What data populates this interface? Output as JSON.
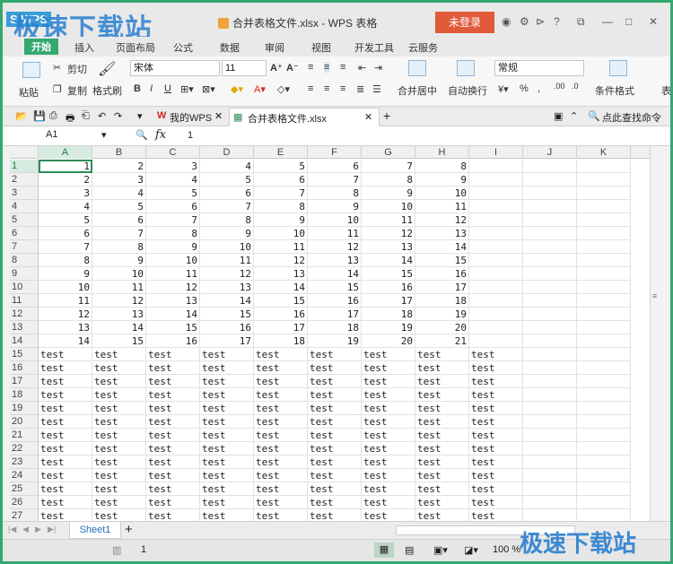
{
  "titlebar": {
    "app_logo": "S WPS",
    "watermark": "极速下载站",
    "doc_title": "合并表格文件.xlsx - WPS 表格",
    "login": "未登录",
    "icons": [
      "skin-icon",
      "settings-icon",
      "share-icon",
      "help-icon",
      "minimize-icon",
      "restore-icon",
      "maximize-icon",
      "close-icon"
    ]
  },
  "ribbon_tabs": [
    "开始",
    "插入",
    "页面布局",
    "公式",
    "数据",
    "审阅",
    "视图",
    "开发工具",
    "云服务"
  ],
  "ribbon": {
    "paste": "粘贴",
    "cut": "剪切",
    "copy": "复制",
    "format_painter": "格式刷",
    "font_name": "宋体",
    "font_size": "11",
    "merge_center": "合并居中",
    "wrap_text": "自动换行",
    "number_format": "常规",
    "conditional_format": "条件格式",
    "last_label": "表"
  },
  "doc_tabs": {
    "my_wps": "我的WPS",
    "active_doc": "合并表格文件.xlsx",
    "search": "点此查找命令"
  },
  "formula_bar": {
    "name_box": "A1",
    "fx": "fx",
    "value": "1"
  },
  "columns": [
    "A",
    "B",
    "C",
    "D",
    "E",
    "F",
    "G",
    "H",
    "I",
    "J",
    "K"
  ],
  "rows": [
    [
      "1",
      "2",
      "3",
      "4",
      "5",
      "6",
      "7",
      "8"
    ],
    [
      "2",
      "3",
      "4",
      "5",
      "6",
      "7",
      "8",
      "9"
    ],
    [
      "3",
      "4",
      "5",
      "6",
      "7",
      "8",
      "9",
      "10"
    ],
    [
      "4",
      "5",
      "6",
      "7",
      "8",
      "9",
      "10",
      "11"
    ],
    [
      "5",
      "6",
      "7",
      "8",
      "9",
      "10",
      "11",
      "12"
    ],
    [
      "6",
      "7",
      "8",
      "9",
      "10",
      "11",
      "12",
      "13"
    ],
    [
      "7",
      "8",
      "9",
      "10",
      "11",
      "12",
      "13",
      "14"
    ],
    [
      "8",
      "9",
      "10",
      "11",
      "12",
      "13",
      "14",
      "15"
    ],
    [
      "9",
      "10",
      "11",
      "12",
      "13",
      "14",
      "15",
      "16"
    ],
    [
      "10",
      "11",
      "12",
      "13",
      "14",
      "15",
      "16",
      "17"
    ],
    [
      "11",
      "12",
      "13",
      "14",
      "15",
      "16",
      "17",
      "18"
    ],
    [
      "12",
      "13",
      "14",
      "15",
      "16",
      "17",
      "18",
      "19"
    ],
    [
      "13",
      "14",
      "15",
      "16",
      "17",
      "18",
      "19",
      "20"
    ],
    [
      "14",
      "15",
      "16",
      "17",
      "18",
      "19",
      "20",
      "21"
    ],
    [
      "test",
      "test",
      "test",
      "test",
      "test",
      "test",
      "test",
      "test",
      "test"
    ],
    [
      "test",
      "test",
      "test",
      "test",
      "test",
      "test",
      "test",
      "test",
      "test"
    ],
    [
      "test",
      "test",
      "test",
      "test",
      "test",
      "test",
      "test",
      "test",
      "test"
    ],
    [
      "test",
      "test",
      "test",
      "test",
      "test",
      "test",
      "test",
      "test",
      "test"
    ],
    [
      "test",
      "test",
      "test",
      "test",
      "test",
      "test",
      "test",
      "test",
      "test"
    ],
    [
      "test",
      "test",
      "test",
      "test",
      "test",
      "test",
      "test",
      "test",
      "test"
    ],
    [
      "test",
      "test",
      "test",
      "test",
      "test",
      "test",
      "test",
      "test",
      "test"
    ],
    [
      "test",
      "test",
      "test",
      "test",
      "test",
      "test",
      "test",
      "test",
      "test"
    ],
    [
      "test",
      "test",
      "test",
      "test",
      "test",
      "test",
      "test",
      "test",
      "test"
    ],
    [
      "test",
      "test",
      "test",
      "test",
      "test",
      "test",
      "test",
      "test",
      "test"
    ],
    [
      "test",
      "test",
      "test",
      "test",
      "test",
      "test",
      "test",
      "test",
      "test"
    ],
    [
      "test",
      "test",
      "test",
      "test",
      "test",
      "test",
      "test",
      "test",
      "test"
    ],
    [
      "test",
      "test",
      "test",
      "test",
      "test",
      "test",
      "test",
      "test",
      "test"
    ]
  ],
  "sheet_tabs": [
    "Sheet1"
  ],
  "statusbar": {
    "page": "1",
    "zoom": "100 %"
  },
  "colors": {
    "accent": "#35a86f",
    "login": "#e05a3a",
    "watermark": "#2a7fd0"
  }
}
